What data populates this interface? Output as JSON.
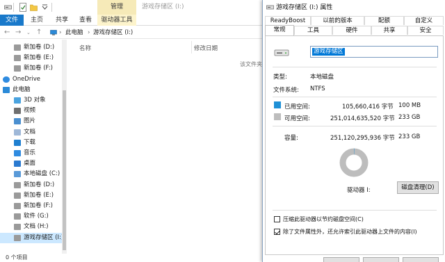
{
  "explorer": {
    "ribbon": {
      "context_header": "管理",
      "window_title": "游戏存储区 (I:)",
      "tabs": {
        "file": "文件",
        "home": "主页",
        "share": "共享",
        "view": "查看",
        "drive_tools": "驱动器工具"
      }
    },
    "address": {
      "pc": "此电脑",
      "sep": "›",
      "drive": "游戏存储区 (I:)"
    },
    "nav": {
      "items": [
        {
          "label": "新加卷 (D:)",
          "icon": "drive-icon"
        },
        {
          "label": "新加卷 (E:)",
          "icon": "drive-icon"
        },
        {
          "label": "新加卷 (F:)",
          "icon": "drive-icon"
        },
        {
          "label": "OneDrive",
          "icon": "cloud-icon"
        },
        {
          "label": "此电脑",
          "icon": "computer-icon"
        },
        {
          "label": "3D 对象",
          "icon": "cube-icon"
        },
        {
          "label": "视频",
          "icon": "video-icon"
        },
        {
          "label": "图片",
          "icon": "pictures-icon"
        },
        {
          "label": "文档",
          "icon": "document-icon"
        },
        {
          "label": "下载",
          "icon": "download-icon"
        },
        {
          "label": "音乐",
          "icon": "music-icon"
        },
        {
          "label": "桌面",
          "icon": "desktop-icon"
        },
        {
          "label": "本地磁盘 (C:)",
          "icon": "system-drive-icon"
        },
        {
          "label": "新加卷 (D:)",
          "icon": "drive-icon"
        },
        {
          "label": "新加卷 (E:)",
          "icon": "drive-icon"
        },
        {
          "label": "新加卷 (F:)",
          "icon": "drive-icon"
        },
        {
          "label": "软件 (G:)",
          "icon": "drive-icon"
        },
        {
          "label": "文档 (H:)",
          "icon": "drive-icon"
        },
        {
          "label": "游戏存储区 (I:)",
          "icon": "drive-icon"
        }
      ]
    },
    "content": {
      "col_name": "名称",
      "col_modified": "修改日期",
      "empty_message": "该文件夹为空。"
    },
    "status": "0 个项目"
  },
  "dialog": {
    "title": "游戏存储区 (I:) 属性",
    "tabs": {
      "readyboost": "ReadyBoost",
      "previous_versions": "以前的版本",
      "quota": "配额",
      "customize": "自定义",
      "general": "常规",
      "tools": "工具",
      "hardware": "硬件",
      "sharing": "共享",
      "security": "安全"
    },
    "general": {
      "name_value": "游戏存储区",
      "type_label": "类型:",
      "type_value": "本地磁盘",
      "fs_label": "文件系统:",
      "fs_value": "NTFS",
      "used_label": "已用空间:",
      "used_bytes": "105,660,416 字节",
      "used_size": "100 MB",
      "free_label": "可用空间:",
      "free_bytes": "251,014,635,520 字节",
      "free_size": "233 GB",
      "capacity_label": "容量:",
      "capacity_bytes": "251,120,295,936 字节",
      "capacity_size": "233 GB",
      "drive_label": "驱动器 I:",
      "cleanup_button": "磁盘清理(D)",
      "compress_label": "压缩此驱动器以节约磁盘空间(C)",
      "compress_checked": false,
      "index_label": "除了文件属性外，还允许索引此驱动器上文件的内容(I)",
      "index_checked": true,
      "used_fraction": 0.0004,
      "used_color": "#1e90d6",
      "free_color": "#bdbdbd"
    }
  }
}
